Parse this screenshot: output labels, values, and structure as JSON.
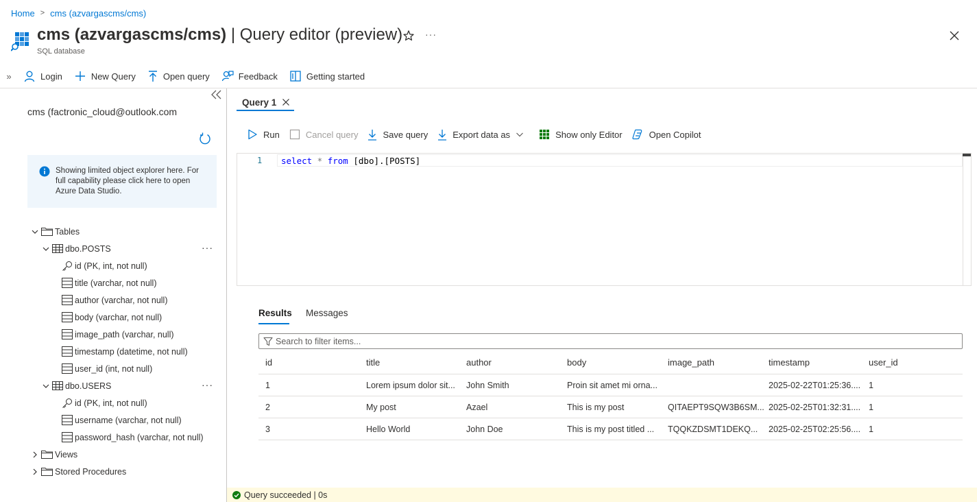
{
  "breadcrumb": {
    "home": "Home",
    "current": "cms (azvargascms/cms)"
  },
  "header": {
    "title_bold": "cms (azvargascms/cms)",
    "title_rest": " | Query editor (preview)",
    "subtitle": "SQL database",
    "more": "···"
  },
  "commandbar": {
    "expand": "»",
    "login": "Login",
    "new_query": "New Query",
    "open_query": "Open query",
    "feedback": "Feedback",
    "getting_started": "Getting started"
  },
  "explorer": {
    "connection": "cms (factronic_cloud@outlook.com",
    "info": "Showing limited object explorer here. For full capability please click here to open Azure Data Studio.",
    "tables_label": "Tables",
    "posts_table": "dbo.POSTS",
    "posts_columns": [
      "id (PK, int, not null)",
      "title (varchar, not null)",
      "author (varchar, not null)",
      "body (varchar, not null)",
      "image_path (varchar, null)",
      "timestamp (datetime, not null)",
      "user_id (int, not null)"
    ],
    "users_table": "dbo.USERS",
    "users_columns": [
      "id (PK, int, not null)",
      "username (varchar, not null)",
      "password_hash (varchar, not null)"
    ],
    "views_label": "Views",
    "procs_label": "Stored Procedures",
    "more": "···"
  },
  "query_tab": {
    "label": "Query 1"
  },
  "editor_toolbar": {
    "run": "Run",
    "cancel": "Cancel query",
    "save": "Save query",
    "export": "Export data as",
    "show_editor": "Show only Editor",
    "copilot": "Open Copilot"
  },
  "editor": {
    "line_number": "1",
    "kw_select": "select",
    "star": " * ",
    "kw_from": "from",
    "rest": " [dbo].[POSTS]"
  },
  "results": {
    "tabs": [
      "Results",
      "Messages"
    ],
    "filter_placeholder": "Search to filter items...",
    "columns": [
      "id",
      "title",
      "author",
      "body",
      "image_path",
      "timestamp",
      "user_id"
    ],
    "rows": [
      [
        "1",
        "Lorem ipsum dolor sit...",
        "John Smith",
        "Proin sit amet mi orna...",
        "",
        "2025-02-22T01:25:36....",
        "1"
      ],
      [
        "2",
        "My post",
        "Azael",
        "This is my post",
        "QITAEPT9SQW3B6SM...",
        "2025-02-25T01:32:31....",
        "1"
      ],
      [
        "3",
        "Hello World",
        "John Doe",
        "This is my post titled ...",
        "TQQKZDSMT1DEKQ...",
        "2025-02-25T02:25:56....",
        "1"
      ]
    ]
  },
  "status": {
    "text": "Query succeeded | 0s",
    "color": "#107c10"
  },
  "colors": {
    "accent": "#0078d4",
    "status_bg": "#fffae0",
    "info_bg": "#eff6fc"
  }
}
